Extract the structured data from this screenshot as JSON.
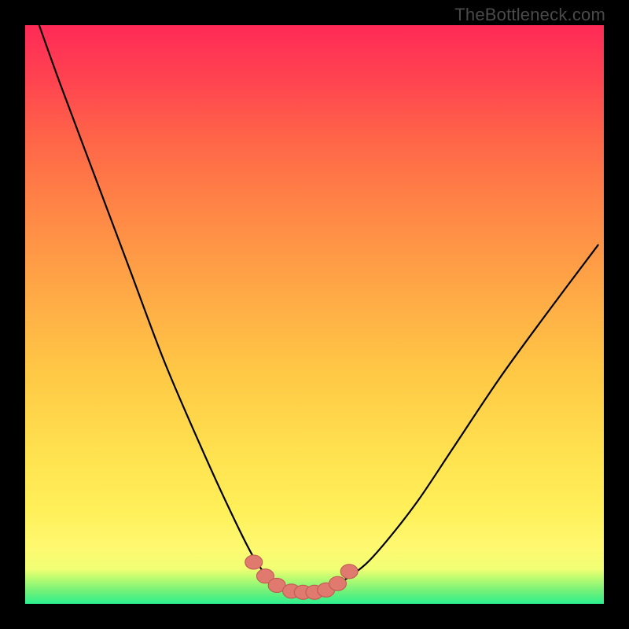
{
  "watermark": "TheBottleneck.com",
  "chart_data": {
    "type": "line",
    "title": "",
    "xlabel": "",
    "ylabel": "",
    "xlim": [
      0,
      1
    ],
    "ylim": [
      0,
      1
    ],
    "series": [
      {
        "name": "curve",
        "x": [
          0.01,
          0.06,
          0.12,
          0.18,
          0.24,
          0.3,
          0.35,
          0.395,
          0.43,
          0.455,
          0.49,
          0.52,
          0.55,
          0.59,
          0.63,
          0.68,
          0.74,
          0.82,
          0.9,
          0.99
        ],
        "y": [
          1.04,
          0.9,
          0.74,
          0.58,
          0.42,
          0.28,
          0.17,
          0.08,
          0.035,
          0.02,
          0.02,
          0.025,
          0.04,
          0.07,
          0.115,
          0.18,
          0.27,
          0.39,
          0.5,
          0.62
        ]
      }
    ],
    "markers": {
      "name": "highlight-points",
      "color": "#e07a6e",
      "x": [
        0.395,
        0.415,
        0.435,
        0.46,
        0.48,
        0.5,
        0.52,
        0.54,
        0.56
      ],
      "y": [
        0.072,
        0.048,
        0.032,
        0.022,
        0.02,
        0.02,
        0.024,
        0.035,
        0.056
      ]
    },
    "background": {
      "type": "vertical-gradient",
      "stops": [
        {
          "pos": 0.0,
          "color": "#2cf08f"
        },
        {
          "pos": 0.06,
          "color": "#f1ff74"
        },
        {
          "pos": 0.25,
          "color": "#ffe350"
        },
        {
          "pos": 0.55,
          "color": "#ffa646"
        },
        {
          "pos": 0.8,
          "color": "#ff6648"
        },
        {
          "pos": 1.0,
          "color": "#ff2a57"
        }
      ]
    }
  }
}
